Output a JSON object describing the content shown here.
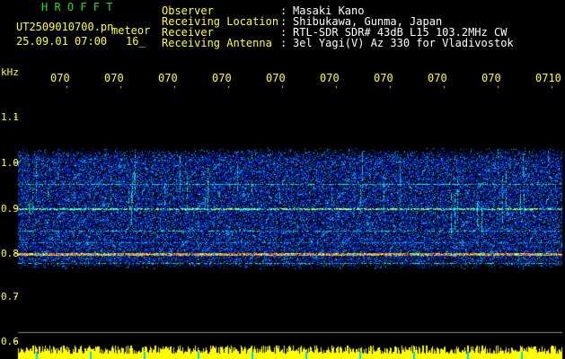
{
  "header": {
    "brand": "H R O F F T",
    "filename": "UT2509010700.pn",
    "type_label": "meteor",
    "timestamp": "25.09.01 07:00",
    "index": "16_",
    "fields": [
      {
        "label": "Observer",
        "value": "Masaki Kano"
      },
      {
        "label": "Receiving Location",
        "value": "Shibukawa, Gunma, Japan"
      },
      {
        "label": "Receiver",
        "value": "RTL-SDR SDR# 43dB L15 103.2MHz CW"
      },
      {
        "label": "Receiving Antenna",
        "value": "3el Yagi(V) Az 330 for Vladivostok"
      }
    ]
  },
  "axis": {
    "unit": "kHz",
    "y_ticks": [
      "1.1",
      "1.0",
      "0.9",
      "0.8",
      "0.7",
      "0.6"
    ],
    "x_ticks": [
      "070",
      "070",
      "070",
      "070",
      "070",
      "070",
      "070",
      "070",
      "070",
      "0710"
    ]
  },
  "colors": {
    "header_brand": "#1fe01f",
    "header_text": "#ffff33",
    "header_values": "#ffffff",
    "background": "#000000",
    "spectrum_low": "#0a1aa0",
    "spectrum_mid": "#00c8ff",
    "spectrum_high": "#ff3030",
    "trace": "#ffff00"
  }
}
